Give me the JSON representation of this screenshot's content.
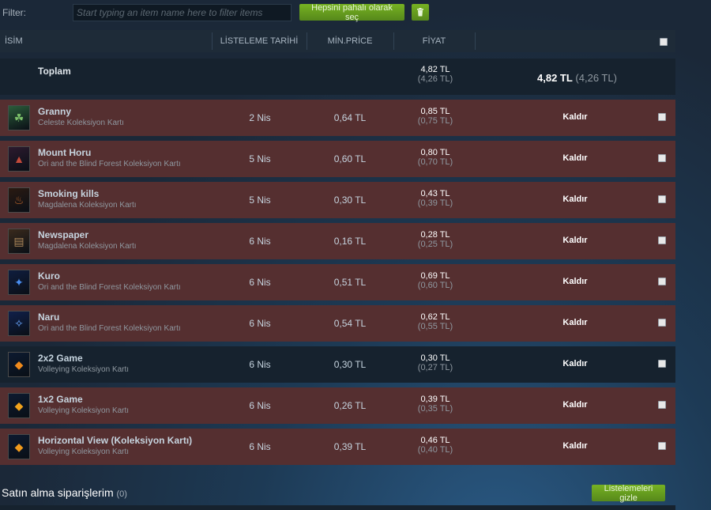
{
  "filter": {
    "label": "Filter:",
    "placeholder": "Start typing an item name here to filter items",
    "select_all_label": "Hepsini pahalı olarak seç",
    "delete_icon": "trash-icon"
  },
  "columns": {
    "name": "İSİM",
    "listed": "LİSTELEME TARİHİ",
    "min_price": "MİN.PRİCE",
    "price": "FİYAT"
  },
  "total": {
    "label": "Toplam",
    "price": "4,82 TL",
    "price_net": "(4,26 TL)",
    "sum_price": "4,82 TL",
    "sum_net": "(4,26 TL)"
  },
  "rows": [
    {
      "name": "Granny",
      "game": "Celeste Koleksiyon Kartı",
      "date": "2 Nis",
      "min_price": "0,64 TL",
      "price": "0,85 TL",
      "price_net": "(0,75 TL)",
      "remove": "Kaldır",
      "thumb_icon": "granny-card-icon",
      "style": "red"
    },
    {
      "name": "Mount Horu",
      "game": "Ori and the Blind Forest Koleksiyon Kartı",
      "date": "5 Nis",
      "min_price": "0,60 TL",
      "price": "0,80 TL",
      "price_net": "(0,70 TL)",
      "remove": "Kaldır",
      "thumb_icon": "mount-horu-card-icon",
      "style": "red"
    },
    {
      "name": "Smoking kills",
      "game": "Magdalena Koleksiyon Kartı",
      "date": "5 Nis",
      "min_price": "0,30 TL",
      "price": "0,43 TL",
      "price_net": "(0,39 TL)",
      "remove": "Kaldır",
      "thumb_icon": "smoking-kills-card-icon",
      "style": "red"
    },
    {
      "name": "Newspaper",
      "game": "Magdalena Koleksiyon Kartı",
      "date": "6 Nis",
      "min_price": "0,16 TL",
      "price": "0,28 TL",
      "price_net": "(0,25 TL)",
      "remove": "Kaldır",
      "thumb_icon": "newspaper-card-icon",
      "style": "red"
    },
    {
      "name": "Kuro",
      "game": "Ori and the Blind Forest Koleksiyon Kartı",
      "date": "6 Nis",
      "min_price": "0,51 TL",
      "price": "0,69 TL",
      "price_net": "(0,60 TL)",
      "remove": "Kaldır",
      "thumb_icon": "kuro-card-icon",
      "style": "red"
    },
    {
      "name": "Naru",
      "game": "Ori and the Blind Forest Koleksiyon Kartı",
      "date": "6 Nis",
      "min_price": "0,54 TL",
      "price": "0,62 TL",
      "price_net": "(0,55 TL)",
      "remove": "Kaldır",
      "thumb_icon": "naru-card-icon",
      "style": "red"
    },
    {
      "name": "2x2 Game",
      "game": "Volleying Koleksiyon Kartı",
      "date": "6 Nis",
      "min_price": "0,30 TL",
      "price": "0,30 TL",
      "price_net": "(0,27 TL)",
      "remove": "Kaldır",
      "thumb_icon": "2x2-game-card-icon",
      "style": "dark"
    },
    {
      "name": "1x2 Game",
      "game": "Volleying Koleksiyon Kartı",
      "date": "6 Nis",
      "min_price": "0,26 TL",
      "price": "0,39 TL",
      "price_net": "(0,35 TL)",
      "remove": "Kaldır",
      "thumb_icon": "1x2-game-card-icon",
      "style": "red"
    },
    {
      "name": "Horizontal View (Koleksiyon Kartı)",
      "game": "Volleying Koleksiyon Kartı",
      "date": "6 Nis",
      "min_price": "0,39 TL",
      "price": "0,46 TL",
      "price_net": "(0,40 TL)",
      "remove": "Kaldır",
      "thumb_icon": "horizontal-view-card-icon",
      "style": "red"
    }
  ],
  "purchases": {
    "title": "Satın alma siparişlerim",
    "count": "(0)",
    "hide_label": "Listelemeleri gizle"
  },
  "colors": {
    "row_red": "#552f30",
    "row_dark": "#16222e",
    "accent_green": "#75b022",
    "background": "#1b2838"
  }
}
